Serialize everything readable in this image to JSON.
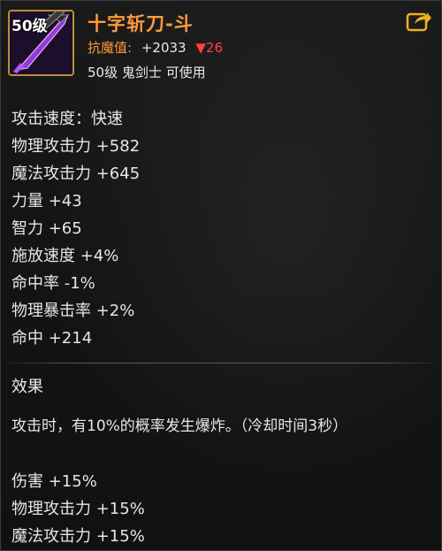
{
  "item": {
    "level_badge": "50级",
    "name": "十字斩刀-斗",
    "resist_label": "抗魔值:",
    "resist_value": "+2033",
    "resist_delta": "▼26",
    "class_requirement": "50级 鬼剑士 可使用",
    "icon": "katana-icon",
    "accent_color": "#ff9a3c",
    "decrease_color": "#ff4040"
  },
  "actions": {
    "share_icon": "share-icon"
  },
  "stats": [
    "攻击速度：快速",
    "物理攻击力 +582",
    "魔法攻击力 +645",
    "力量 +43",
    "智力 +65",
    "施放速度 +4%",
    "命中率 -1%",
    "物理暴击率 +2%",
    "命中 +214"
  ],
  "effect": {
    "title": "效果",
    "description": "攻击时，有10%的概率发生爆炸。（冷却时间3秒）",
    "bonuses": [
      "伤害 +15%",
      "物理攻击力 +15%",
      "魔法攻击力 +15%"
    ]
  }
}
